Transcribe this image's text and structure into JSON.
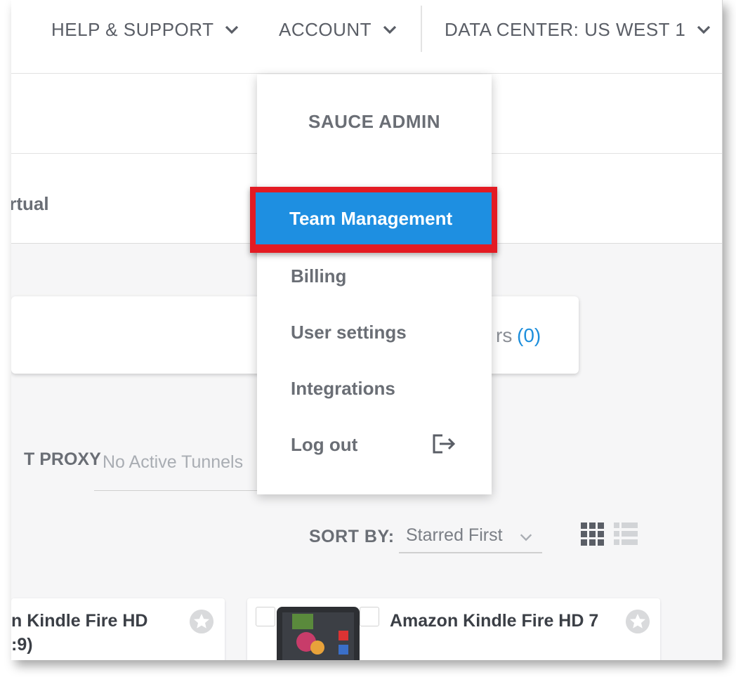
{
  "topnav": {
    "help_label": "HELP & SUPPORT",
    "account_label": "ACCOUNT",
    "datacenter_label": "DATA CENTER: US WEST 1"
  },
  "tabs": {
    "virtual_label": "irtual"
  },
  "filters": {
    "label_fragment": "rs",
    "count": "(0)"
  },
  "proxy": {
    "label": "T PROXY",
    "value": "No Active Tunnels"
  },
  "sort": {
    "label": "SORT BY:",
    "value": "Starred First"
  },
  "devices": [
    {
      "name_line1": "n Kindle Fire HD",
      "name_line2": ":9)"
    },
    {
      "name_line1": "Amazon Kindle Fire HD 7"
    }
  ],
  "account_menu": {
    "header": "SAUCE ADMIN",
    "items": [
      "Team Management",
      "Billing",
      "User settings",
      "Integrations",
      "Log out"
    ],
    "active_item": "Team Management"
  },
  "colors": {
    "accent_blue": "#1e8fe1",
    "highlight_red": "#e31b23",
    "text_gray": "#6a6e75"
  },
  "icons": [
    "chevron-down-icon",
    "logout-icon",
    "star-icon",
    "grid-view-icon",
    "list-view-icon"
  ]
}
